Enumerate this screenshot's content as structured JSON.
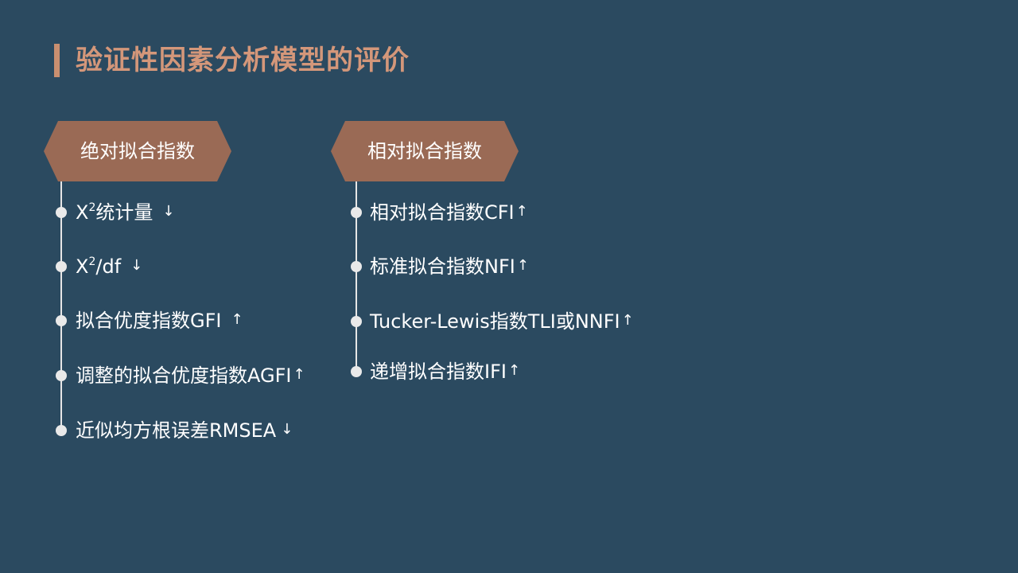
{
  "title": "验证性因素分析模型的评价",
  "absolute": {
    "header": "绝对拟合指数",
    "items": [
      {
        "pre": "X",
        "sup": "2",
        "post": "统计量",
        "arrow": "↓"
      },
      {
        "pre": "X",
        "sup": "2",
        "post": "/df",
        "arrow": "↓"
      },
      {
        "pre": "拟合优度指数GFI",
        "sup": "",
        "post": "",
        "arrow": "↑"
      },
      {
        "pre": "调整的拟合优度指数AGFI",
        "sup": "",
        "post": "",
        "arrow": "↑"
      },
      {
        "pre": "近似均方根误差RMSEA",
        "sup": "",
        "post": "",
        "arrow": "↓"
      }
    ]
  },
  "relative": {
    "header": "相对拟合指数",
    "items": [
      {
        "text": "相对拟合指数CFI",
        "arrow": "↑"
      },
      {
        "text": "标准拟合指数NFI",
        "arrow": "↑"
      },
      {
        "text": "Tucker-Lewis指数TLI或NNFI",
        "arrow": "↑"
      },
      {
        "text": "递增拟合指数IFI",
        "arrow": "↑"
      }
    ]
  },
  "colors": {
    "background": "#2b4a60",
    "accent": "#c98f70",
    "hexagon": "#9a6a55"
  }
}
